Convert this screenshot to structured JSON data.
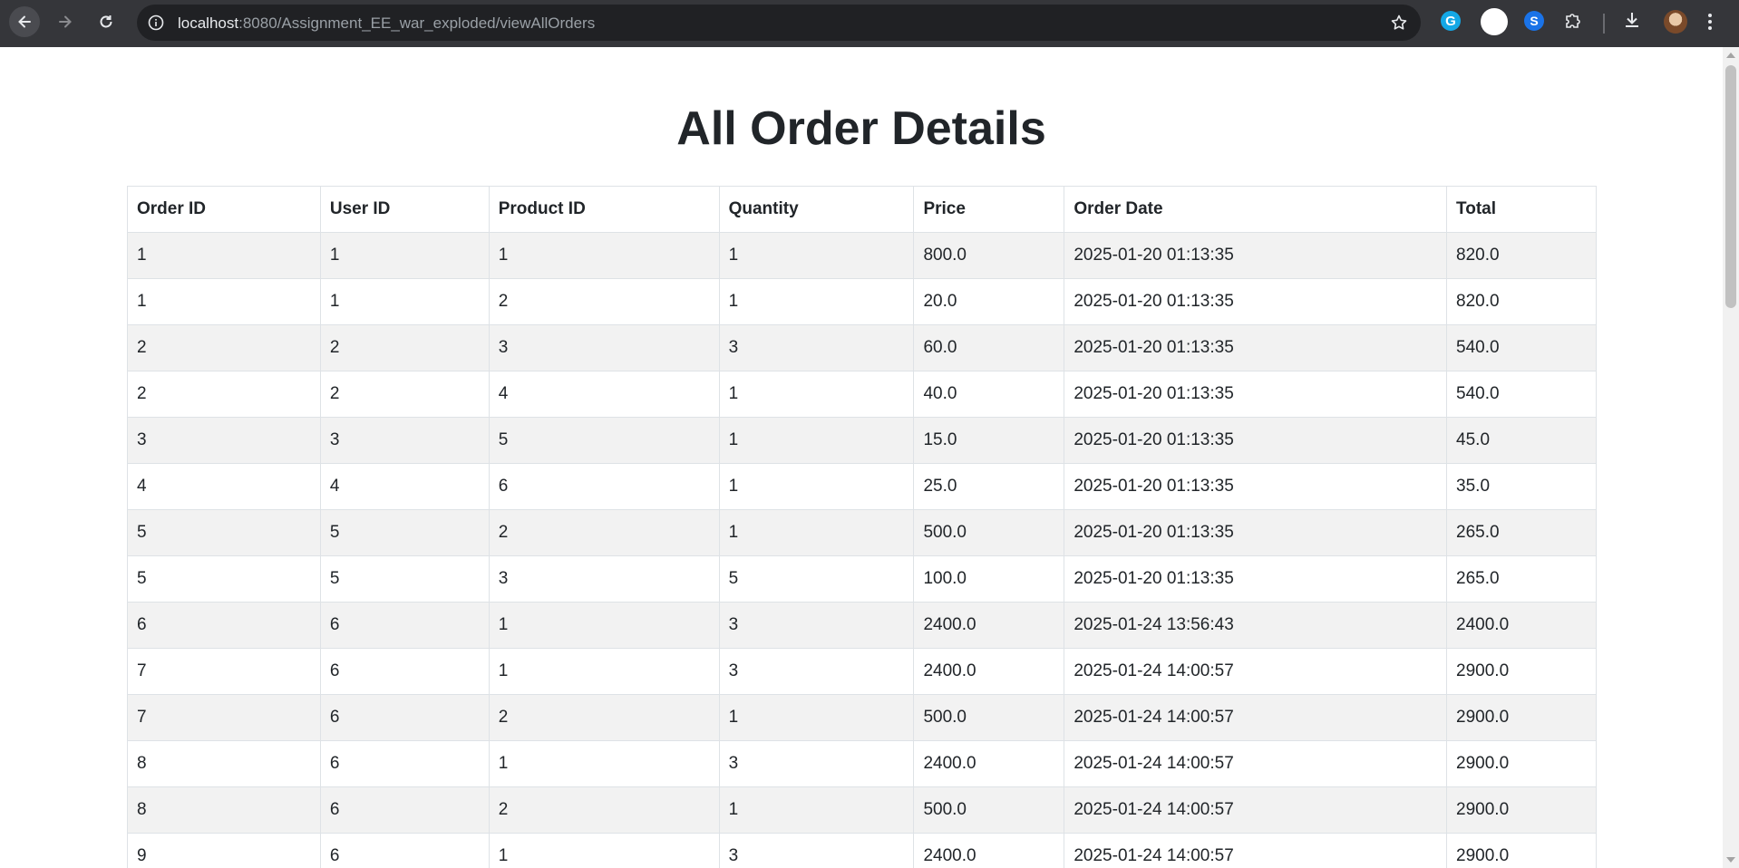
{
  "browser": {
    "url_host": "localhost",
    "url_rest": ":8080/Assignment_EE_war_exploded/viewAllOrders",
    "extension_g_label": "G",
    "extension_shazam_label": "S"
  },
  "page": {
    "title": "All Order Details"
  },
  "table": {
    "headers": [
      "Order ID",
      "User ID",
      "Product ID",
      "Quantity",
      "Price",
      "Order Date",
      "Total"
    ],
    "rows": [
      [
        "1",
        "1",
        "1",
        "1",
        "800.0",
        "2025-01-20 01:13:35",
        "820.0"
      ],
      [
        "1",
        "1",
        "2",
        "1",
        "20.0",
        "2025-01-20 01:13:35",
        "820.0"
      ],
      [
        "2",
        "2",
        "3",
        "3",
        "60.0",
        "2025-01-20 01:13:35",
        "540.0"
      ],
      [
        "2",
        "2",
        "4",
        "1",
        "40.0",
        "2025-01-20 01:13:35",
        "540.0"
      ],
      [
        "3",
        "3",
        "5",
        "1",
        "15.0",
        "2025-01-20 01:13:35",
        "45.0"
      ],
      [
        "4",
        "4",
        "6",
        "1",
        "25.0",
        "2025-01-20 01:13:35",
        "35.0"
      ],
      [
        "5",
        "5",
        "2",
        "1",
        "500.0",
        "2025-01-20 01:13:35",
        "265.0"
      ],
      [
        "5",
        "5",
        "3",
        "5",
        "100.0",
        "2025-01-20 01:13:35",
        "265.0"
      ],
      [
        "6",
        "6",
        "1",
        "3",
        "2400.0",
        "2025-01-24 13:56:43",
        "2400.0"
      ],
      [
        "7",
        "6",
        "1",
        "3",
        "2400.0",
        "2025-01-24 14:00:57",
        "2900.0"
      ],
      [
        "7",
        "6",
        "2",
        "1",
        "500.0",
        "2025-01-24 14:00:57",
        "2900.0"
      ],
      [
        "8",
        "6",
        "1",
        "3",
        "2400.0",
        "2025-01-24 14:00:57",
        "2900.0"
      ],
      [
        "8",
        "6",
        "2",
        "1",
        "500.0",
        "2025-01-24 14:00:57",
        "2900.0"
      ],
      [
        "9",
        "6",
        "1",
        "3",
        "2400.0",
        "2025-01-24 14:00:57",
        "2900.0"
      ]
    ]
  },
  "colors": {
    "chrome_bg": "#35363a",
    "omnibox_bg": "#202124",
    "table_border": "#dee2e6",
    "row_stripe": "#f2f2f2"
  }
}
